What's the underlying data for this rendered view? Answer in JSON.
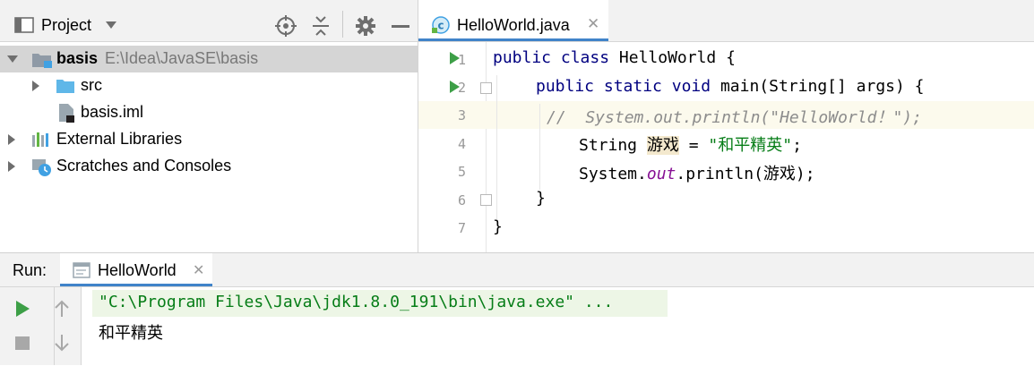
{
  "project_panel": {
    "title": "Project",
    "tree": [
      {
        "name": "basis",
        "path": "E:\\Idea\\JavaSE\\basis"
      },
      {
        "name": "src"
      },
      {
        "name": "basis.iml"
      },
      {
        "name": "External Libraries"
      },
      {
        "name": "Scratches and Consoles"
      }
    ]
  },
  "editor": {
    "tab_label": "HelloWorld.java",
    "line_numbers": [
      "1",
      "2",
      "3",
      "4",
      "5",
      "6",
      "7"
    ],
    "code": {
      "l1_kw1": "public",
      "l1_kw2": "class",
      "l1_rest": " HelloWorld {",
      "l2_kw1": "public",
      "l2_kw2": "static",
      "l2_kw3": "void",
      "l2_rest": " main(String[] args) {",
      "l3_comment": "//  System.out.println(\"HelloWorld！\");",
      "l4_type": "String ",
      "l4_var": "游戏",
      "l4_eq": " = ",
      "l4_str": "\"和平精英\"",
      "l4_end": ";",
      "l5_a": "System.",
      "l5_field": "out",
      "l5_b": ".println(游戏);",
      "l6": "}",
      "l7": "}"
    }
  },
  "run_panel": {
    "label": "Run:",
    "tab_label": "HelloWorld",
    "console_lines": [
      "\"C:\\Program Files\\Java\\jdk1.8.0_191\\bin\\java.exe\" ...",
      "和平精英"
    ]
  },
  "colors": {
    "keyword": "#000080",
    "string": "#067d17",
    "comment": "#8c8c8c",
    "static_field": "#871094",
    "run_green": "#3d9f47",
    "selection": "#d5d5d5",
    "tab_underline": "#4083c9"
  }
}
